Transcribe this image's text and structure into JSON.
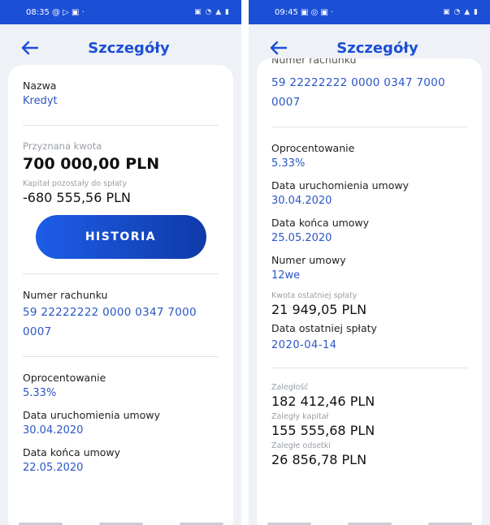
{
  "left": {
    "status": {
      "time": "08:35 @ ▷ ▣ ·",
      "icons": "▣ ◔ ▲ ▮"
    },
    "title": "Szczegóły",
    "nazwa_label": "Nazwa",
    "nazwa_value": "Kredyt",
    "amount_label": "Przyznana kwota",
    "amount_value": "700 000,00 PLN",
    "remaining_label": "Kapitał pozostały do spłaty",
    "remaining_value": "-680 555,56 PLN",
    "history_button": "HISTORIA",
    "account_label": "Numer rachunku",
    "account_line1": "59 22222222 0000 0347 7000",
    "account_line2": "0007",
    "rate_label": "Oprocentowanie",
    "rate_value": "5.33%",
    "start_label": "Data uruchomienia umowy",
    "start_value": "30.04.2020",
    "end_label": "Data końca umowy",
    "end_value": "22.05.2020"
  },
  "right": {
    "status": {
      "time": "09:45 ▣ ◎ ▣ ·",
      "icons": "▣ ◔ ▲ ▮"
    },
    "title": "Szczegóły",
    "account_label_partial": "Numer rachunku",
    "account_line1": "59 22222222 0000 0347 7000",
    "account_line2": "0007",
    "rate_label": "Oprocentowanie",
    "rate_value": "5.33%",
    "start_label": "Data uruchomienia umowy",
    "start_value": "30.04.2020",
    "end_label": "Data końca umowy",
    "end_value": "25.05.2020",
    "contract_label": "Numer umowy",
    "contract_value": "12we",
    "last_payment_amount_label": "Kwota ostatniej spłaty",
    "last_payment_amount_value": "21 949,05 PLN",
    "last_payment_date_label": "Data ostatniej spłaty",
    "last_payment_date_value": "2020-04-14",
    "arrears_label": "Zaległość",
    "arrears_value": "182 412,46 PLN",
    "arrears_capital_label": "Zaległy kapitał",
    "arrears_capital_value": "155 555,68 PLN",
    "arrears_interest_label": "Zaległe odsetki",
    "arrears_interest_value": "26 856,78 PLN"
  },
  "colors": {
    "accent": "#1b4fd6",
    "link": "#2b56c6",
    "background": "#eef1f6"
  }
}
